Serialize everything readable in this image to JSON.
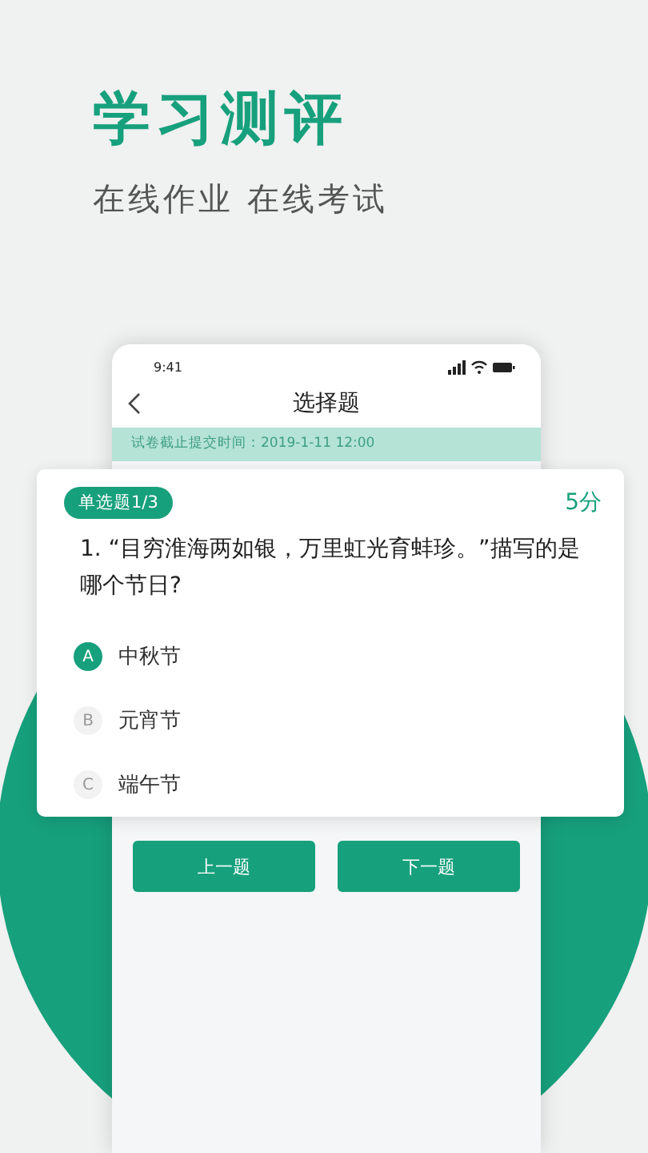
{
  "header": {
    "title": "学习测评",
    "subtitle": "在线作业 在线考试"
  },
  "phone": {
    "time": "9:41",
    "title": "选择题",
    "deadline": "试卷截止提交时间：2019-1-11 12:00",
    "buttons": [
      "上一题",
      "下一题"
    ]
  },
  "question": {
    "tag": "单选题1/3",
    "score": "5分",
    "text": "1. “目穷淮海两如银，万里虹光育蚌珍。”描写的是哪个节日?",
    "options": [
      {
        "letter": "A",
        "label": "中秋节",
        "selected": true
      },
      {
        "letter": "B",
        "label": "元宵节",
        "selected": false
      },
      {
        "letter": "C",
        "label": "端午节",
        "selected": false
      }
    ]
  }
}
